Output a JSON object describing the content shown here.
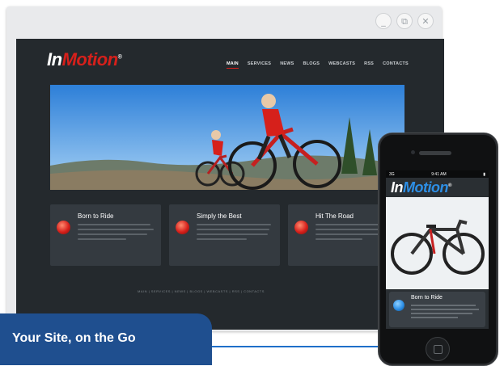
{
  "window": {
    "controls": {
      "minimize": "_",
      "restore": "⧉",
      "close": "✕"
    }
  },
  "site": {
    "logo": {
      "part1": "In",
      "part2": "Motion",
      "mark": "®"
    },
    "nav": [
      "MAIN",
      "SERVICES",
      "NEWS",
      "BLOGS",
      "WEBCASTS",
      "RSS",
      "CONTACTS"
    ],
    "active_nav": "MAIN",
    "cards": [
      {
        "title": "Born to Ride"
      },
      {
        "title": "Simply the Best"
      },
      {
        "title": "Hit The Road"
      }
    ],
    "footer_nav": "MAIN | SERVICES | NEWS | BLOGS | WEBCASTS | RSS | CONTACTS"
  },
  "phone": {
    "carrier": "3G",
    "time": "9:41 AM",
    "logo": {
      "part1": "In",
      "part2": "Motion",
      "mark": "®"
    },
    "card_title": "Born to Ride"
  },
  "banner": {
    "text": "Your Site, on the Go"
  },
  "colors": {
    "brand_red": "#d6201b",
    "brand_blue": "#2d8fe6",
    "banner_blue": "#1f4f8f"
  }
}
